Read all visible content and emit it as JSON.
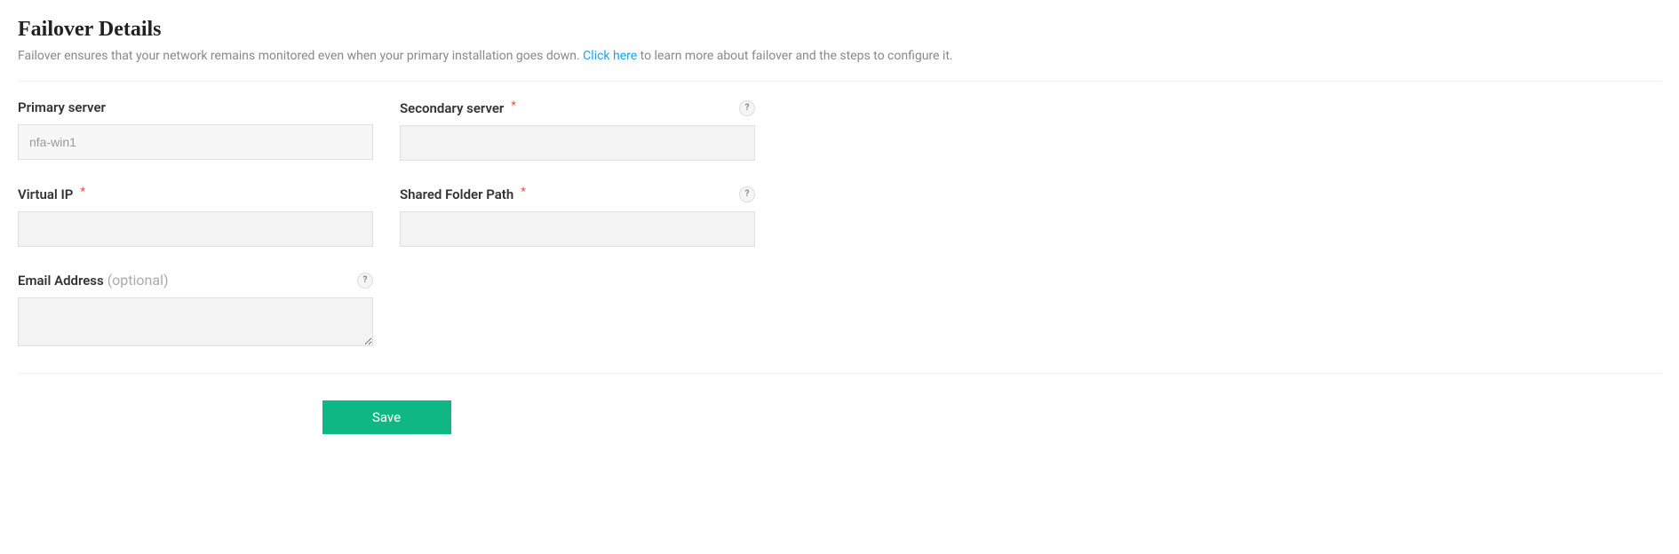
{
  "header": {
    "title": "Failover Details",
    "description_pre": "Failover ensures that your network remains monitored even when your primary installation goes down. ",
    "link_text": "Click here",
    "description_post": " to learn more about failover and the steps to configure it."
  },
  "form": {
    "primary_server": {
      "label": "Primary server",
      "value": "nfa-win1"
    },
    "secondary_server": {
      "label": "Secondary server",
      "value": ""
    },
    "virtual_ip": {
      "label": "Virtual IP",
      "value": ""
    },
    "shared_folder_path": {
      "label": "Shared Folder Path",
      "value": ""
    },
    "email_address": {
      "label": "Email Address",
      "optional_text": "(optional)",
      "value": ""
    }
  },
  "buttons": {
    "save": "Save"
  },
  "icons": {
    "help": "?"
  },
  "required_marker": "*"
}
